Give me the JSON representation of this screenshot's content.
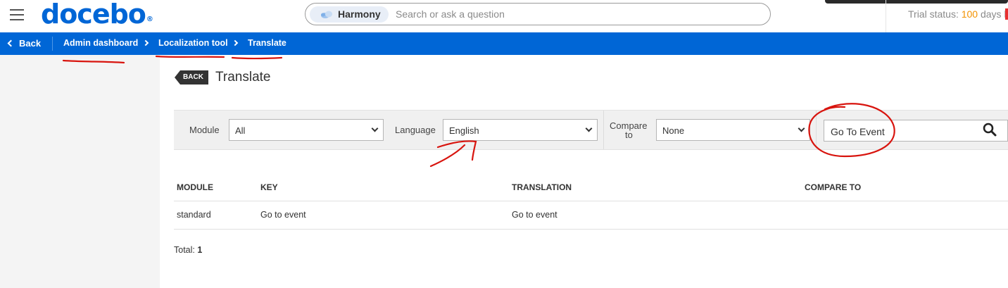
{
  "header": {
    "logo": "docebo",
    "search": {
      "chip_label": "Harmony",
      "placeholder": "Search or ask a question"
    },
    "trial": {
      "prefix": "Trial status:",
      "days": "100",
      "suffix": "days l"
    }
  },
  "breadcrumb": {
    "back_label": "Back",
    "items": [
      "Admin dashboard",
      "Localization tool",
      "Translate"
    ]
  },
  "page": {
    "back_tag": "BACK",
    "title": "Translate"
  },
  "filters": {
    "module_label": "Module",
    "module_value": "All",
    "language_label": "Language",
    "language_value": "English",
    "compare_label_1": "Compare",
    "compare_label_2": "to",
    "compare_value": "None",
    "search_value": "Go To Event"
  },
  "table": {
    "headers": [
      "MODULE",
      "KEY",
      "TRANSLATION",
      "COMPARE TO"
    ],
    "rows": [
      {
        "module": "standard",
        "key": "Go to event",
        "translation": "Go to event",
        "compare_to": ""
      }
    ]
  },
  "total": {
    "label": "Total:",
    "value": "1"
  },
  "colors": {
    "brand_blue": "#0066d6",
    "annotation_red": "#d8140e",
    "trial_orange": "#f29200"
  }
}
